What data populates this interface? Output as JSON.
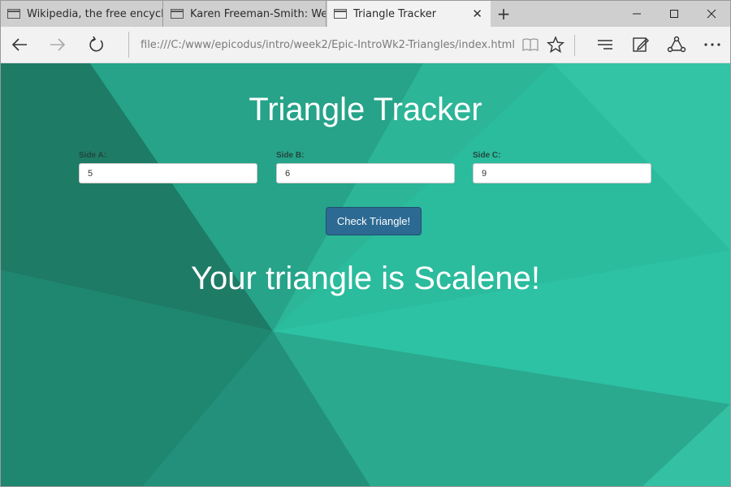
{
  "browser": {
    "tabs": [
      {
        "label": "Wikipedia, the free encyclop",
        "active": false
      },
      {
        "label": "Karen Freeman-Smith: Web",
        "active": false
      },
      {
        "label": "Triangle Tracker",
        "active": true
      }
    ],
    "address": "file:///C:/www/epicodus/intro/week2/Epic-IntroWk2-Triangles/index.html",
    "icons": [
      "back-arrow-icon",
      "forward-arrow-icon",
      "refresh-icon",
      "reading-view-icon",
      "favorite-star-icon",
      "hub-icon",
      "web-note-icon",
      "share-icon",
      "more-icon",
      "minimize-icon",
      "maximize-icon",
      "close-icon",
      "new-tab-icon"
    ]
  },
  "page": {
    "title": "Triangle Tracker",
    "fields": [
      {
        "label": "Side A:",
        "value": "5"
      },
      {
        "label": "Side B:",
        "value": "6"
      },
      {
        "label": "Side C:",
        "value": "9"
      }
    ],
    "button_label": "Check Triangle!",
    "result": "Your triangle is Scalene!"
  },
  "colors": {
    "background": "#2bbd9f",
    "button": "#2c6a93",
    "text": "#ffffff"
  }
}
